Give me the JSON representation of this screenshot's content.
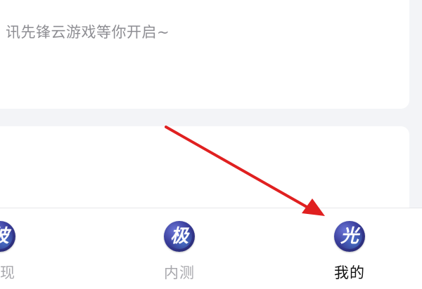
{
  "top_card": {
    "text": "讯先锋云游戏等你开启~"
  },
  "tab_bar": {
    "tabs": [
      {
        "label": "发现",
        "icon_glyph": "彼",
        "icon": "game-logo-icon",
        "active": false
      },
      {
        "label": "内测",
        "icon_glyph": "极",
        "icon": "game-logo-icon",
        "active": false
      },
      {
        "label": "我的",
        "icon_glyph": "光",
        "icon": "game-logo-icon",
        "active": true
      }
    ]
  },
  "annotation": {
    "arrow_color": "#e02020"
  },
  "colors": {
    "background": "#f3f4f7",
    "card": "#ffffff",
    "inactive_label": "#a8a8ad",
    "active_label": "#111111"
  }
}
